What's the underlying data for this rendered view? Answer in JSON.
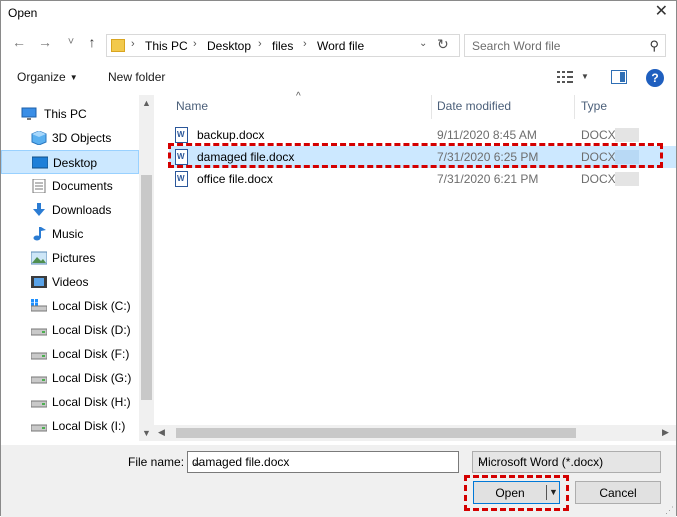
{
  "window": {
    "title": "Open",
    "close_glyph": "✕"
  },
  "nav": {
    "back_glyph": "←",
    "forward_glyph": "→",
    "recent_glyph": "˅",
    "up_glyph": "↑",
    "breadcrumbs": [
      "This PC",
      "Desktop",
      "files",
      "Word file"
    ],
    "sep_glyph": "›",
    "dd_glyph": "⌄",
    "refresh_glyph": "↻",
    "search_placeholder": "Search Word file",
    "search_glyph": "⚲"
  },
  "toolbar": {
    "organize": "Organize",
    "organize_caret": "▼",
    "new_folder": "New folder",
    "view_caret": "▼",
    "help": "?"
  },
  "sidebar": {
    "items": [
      {
        "label": "This PC",
        "icon": "pc-icon"
      },
      {
        "label": "3D Objects",
        "icon": "cube-icon"
      },
      {
        "label": "Desktop",
        "icon": "desktop-icon",
        "selected": true
      },
      {
        "label": "Documents",
        "icon": "documents-icon"
      },
      {
        "label": "Downloads",
        "icon": "downloads-icon"
      },
      {
        "label": "Music",
        "icon": "music-icon"
      },
      {
        "label": "Pictures",
        "icon": "pictures-icon"
      },
      {
        "label": "Videos",
        "icon": "videos-icon"
      },
      {
        "label": "Local Disk (C:)",
        "icon": "drive-icon"
      },
      {
        "label": "Local Disk (D:)",
        "icon": "drive-icon"
      },
      {
        "label": "Local Disk (F:)",
        "icon": "drive-icon"
      },
      {
        "label": "Local Disk (G:)",
        "icon": "drive-icon"
      },
      {
        "label": "Local Disk (H:)",
        "icon": "drive-icon"
      },
      {
        "label": "Local Disk (I:)",
        "icon": "drive-icon"
      }
    ],
    "scroll_up": "▲",
    "scroll_down": "▼"
  },
  "files": {
    "columns": [
      "Name",
      "Date modified",
      "Type"
    ],
    "sort_glyph": "^",
    "rows": [
      {
        "name": "backup.docx",
        "date": "9/11/2020 8:45 AM",
        "type": "DOCX"
      },
      {
        "name": "damaged file.docx",
        "date": "7/31/2020 6:25 PM",
        "type": "DOCX",
        "selected": true
      },
      {
        "name": "office file.docx",
        "date": "7/31/2020 6:21 PM",
        "type": "DOCX"
      }
    ],
    "hscroll_left": "◀",
    "hscroll_right": "▶"
  },
  "bottom": {
    "file_name_label": "File name:",
    "file_name_value": "damaged file.docx",
    "dd_glyph": "⌄",
    "filter_value": "Microsoft Word (*.docx)",
    "open_label": "Open",
    "open_dd": "▼",
    "cancel_label": "Cancel",
    "grip": "⋰"
  },
  "colors": {
    "highlight_dash": "#d40000",
    "selection": "#cce8ff",
    "accent": "#0078d7"
  }
}
